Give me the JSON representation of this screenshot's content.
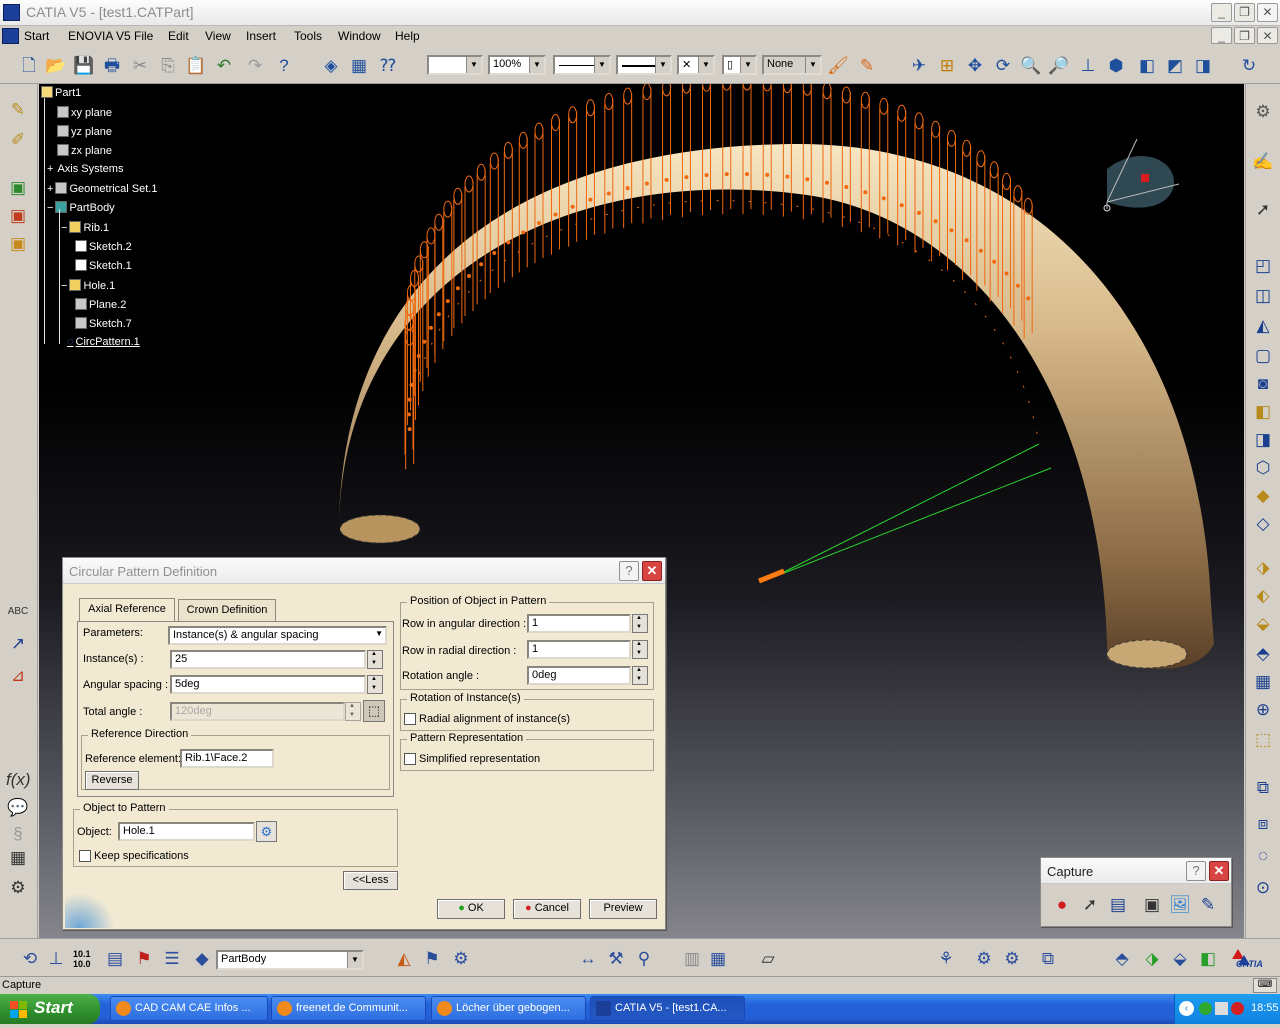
{
  "window": {
    "title": "CATIA V5 - [test1.CATPart]"
  },
  "menubar": {
    "items": [
      "Start",
      "ENOVIA V5",
      "File",
      "Edit",
      "View",
      "Insert",
      "Tools",
      "Window",
      "Help"
    ]
  },
  "toolbar": {
    "zoom_value": "100%",
    "layer_value": "None"
  },
  "spec_tree": {
    "root": "Part1",
    "nodes": [
      "xy plane",
      "yz plane",
      "zx plane",
      "Axis Systems",
      "Geometrical Set.1",
      "PartBody",
      "Rib.1",
      "Sketch.2",
      "Sketch.1",
      "Hole.1",
      "Plane.2",
      "Sketch.7",
      "CircPattern.1"
    ]
  },
  "dialog": {
    "title": "Circular Pattern Definition",
    "tabs": [
      "Axial Reference",
      "Crown Definition"
    ],
    "parameters_label": "Parameters:",
    "parameters_value": "Instance(s) & angular spacing",
    "instances_label": "Instance(s) :",
    "instances_value": "25",
    "angular_spacing_label": "Angular spacing :",
    "angular_spacing_value": "5deg",
    "total_angle_label": "Total angle :",
    "total_angle_value": "120deg",
    "reference_direction_legend": "Reference Direction",
    "reference_element_label": "Reference element:",
    "reference_element_value": "Rib.1\\Face.2",
    "reverse_label": "Reverse",
    "object_to_pattern_legend": "Object to Pattern",
    "object_label": "Object:",
    "object_value": "Hole.1",
    "keep_specifications_label": "Keep specifications",
    "position_legend": "Position of Object in Pattern",
    "row_angular_label": "Row in angular direction :",
    "row_angular_value": "1",
    "row_radial_label": "Row in radial direction :",
    "row_radial_value": "1",
    "rotation_angle_label": "Rotation angle :",
    "rotation_angle_value": "0deg",
    "rotation_instances_legend": "Rotation of Instance(s)",
    "radial_alignment_label": "Radial alignment of instance(s)",
    "pattern_representation_legend": "Pattern Representation",
    "simplified_label": "Simplified representation",
    "less_label": "<<Less",
    "ok_label": "OK",
    "cancel_label": "Cancel",
    "preview_label": "Preview"
  },
  "capture": {
    "title": "Capture"
  },
  "bottom_toolbar": {
    "body_value": "PartBody",
    "brand": "CATIA",
    "coord_top": "10.1",
    "coord_bottom": "10.0"
  },
  "statusbar": {
    "text": "Capture"
  },
  "taskbar": {
    "start_label": "Start",
    "tasks": [
      "CAD CAM CAE Infos ...",
      "freenet.de Communit...",
      "Löcher über gebogen...",
      "CATIA V5 - [test1.CA..."
    ],
    "clock": "18:55"
  }
}
